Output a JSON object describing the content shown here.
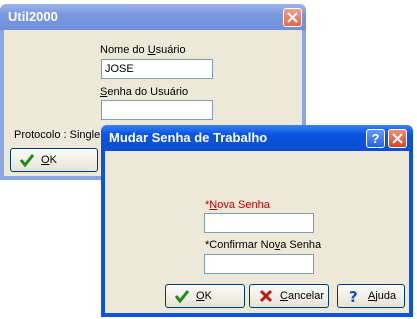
{
  "login_window": {
    "title": "Util2000",
    "username_label_pre": "Nome do ",
    "username_label_key": "U",
    "username_label_post": "suário",
    "username_value": "JOSE",
    "password_label_key": "S",
    "password_label_post": "enha do Usuário",
    "password_value": "",
    "protocol_text": "Protocolo : SingleU",
    "ok_key": "O",
    "ok_post": "K"
  },
  "change_password_dialog": {
    "title": "Mudar Senha de Trabalho",
    "help_glyph": "?",
    "new_password_star": "*",
    "new_password_key": "N",
    "new_password_post": "ova Senha",
    "confirm_label_pre": "*Confirmar No",
    "confirm_label_key": "v",
    "confirm_label_post": "a Senha",
    "ok_key": "O",
    "ok_post": "K",
    "cancel_key": "C",
    "cancel_post": "ancelar",
    "help_key": "A",
    "help_post": "juda"
  },
  "colors": {
    "active_title": "#0a55e0",
    "inactive_title": "#7b97e0",
    "required_label": "#cc0000",
    "close_button": "#e0482d"
  }
}
